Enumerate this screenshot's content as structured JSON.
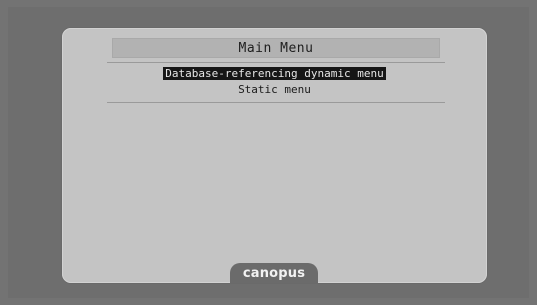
{
  "menu": {
    "title": "Main Menu",
    "items": [
      {
        "label": "Database-referencing dynamic menu",
        "selected": true
      },
      {
        "label": "Static menu",
        "selected": false
      }
    ]
  },
  "brand": {
    "logo_text": "canopus"
  },
  "colors": {
    "background": "#737373",
    "panel": "#c4c4c4",
    "title_bar": "#b2b2b2",
    "selection": "#161616",
    "logo_tab": "#6b6b6b"
  }
}
